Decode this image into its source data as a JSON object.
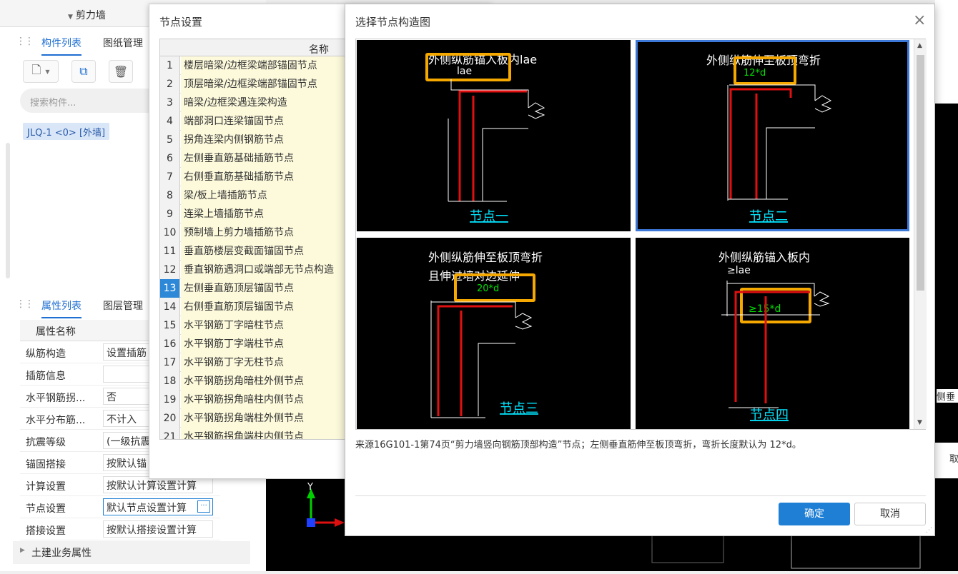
{
  "app": {
    "wall_type": "剪力墙",
    "tabs_top": [
      "构件列表",
      "图纸管理"
    ],
    "search_placeholder": "搜索构件...",
    "component": "JLQ-1 <0> [外墙]",
    "tabs_bottom": [
      "属性列表",
      "图层管理"
    ],
    "prop_header": "属性名称",
    "props": [
      {
        "name": "纵筋构造",
        "value": "设置插筋"
      },
      {
        "name": "插筋信息",
        "value": ""
      },
      {
        "name": "水平钢筋拐...",
        "value": "否"
      },
      {
        "name": "水平分布筋...",
        "value": "不计入"
      },
      {
        "name": "抗震等级",
        "value": "(一级抗震"
      },
      {
        "name": "锚固搭接",
        "value": "按默认锚"
      },
      {
        "name": "计算设置",
        "value": "按默认计算设置计算"
      },
      {
        "name": "节点设置",
        "value": "默认节点设置计算"
      },
      {
        "name": "搭接设置",
        "value": "按默认搭接设置计算"
      }
    ],
    "civil_section": "土建业务属性",
    "right_clipped": "侧垂",
    "right_clipped2": "取"
  },
  "node_dialog": {
    "title": "节点设置",
    "column_header": "名称",
    "rows": [
      {
        "num": "1",
        "name": "楼层暗梁/边框梁端部锚固节点"
      },
      {
        "num": "2",
        "name": "顶层暗梁/边框梁端部锚固节点"
      },
      {
        "num": "3",
        "name": "暗梁/边框梁遇连梁构造"
      },
      {
        "num": "4",
        "name": "端部洞口连梁锚固节点"
      },
      {
        "num": "5",
        "name": "拐角连梁内侧钢筋节点"
      },
      {
        "num": "6",
        "name": "左侧垂直筋基础插筋节点"
      },
      {
        "num": "7",
        "name": "右侧垂直筋基础插筋节点"
      },
      {
        "num": "8",
        "name": "梁/板上墙插筋节点"
      },
      {
        "num": "9",
        "name": "连梁上墙插筋节点"
      },
      {
        "num": "10",
        "name": "预制墙上剪力墙插筋节点"
      },
      {
        "num": "11",
        "name": "垂直筋楼层变截面锚固节点"
      },
      {
        "num": "12",
        "name": "垂直钢筋遇洞口或端部无节点构造"
      },
      {
        "num": "13",
        "name": "左侧垂直筋顶层锚固节点"
      },
      {
        "num": "14",
        "name": "右侧垂直筋顶层锚固节点"
      },
      {
        "num": "15",
        "name": "水平钢筋丁字暗柱节点"
      },
      {
        "num": "16",
        "name": "水平钢筋丁字端柱节点"
      },
      {
        "num": "17",
        "name": "水平钢筋丁字无柱节点"
      },
      {
        "num": "18",
        "name": "水平钢筋拐角暗柱外侧节点"
      },
      {
        "num": "19",
        "name": "水平钢筋拐角暗柱内侧节点"
      },
      {
        "num": "20",
        "name": "水平钢筋拐角端柱外侧节点"
      },
      {
        "num": "21",
        "name": "水平钢筋拐角端柱内侧节点"
      }
    ],
    "selected_row": "13"
  },
  "select_dialog": {
    "title": "选择节点构造图",
    "close": "×",
    "nodes": [
      {
        "heading1": "外侧纵筋锚入板内lae",
        "heading2": "",
        "dim": "lae",
        "dim_green": "",
        "label": "节点一"
      },
      {
        "heading1": "外侧纵筋伸至板顶弯折",
        "heading2": "",
        "dim": "",
        "dim_green": "12*d",
        "label": "节点二"
      },
      {
        "heading1": "外侧纵筋伸至板顶弯折",
        "heading2": "且伸过墙对边延伸",
        "dim": "",
        "dim_green": "20*d",
        "label": "节点三"
      },
      {
        "heading1": "外侧纵筋锚入板内",
        "heading2": "≥lae",
        "dim": "",
        "dim_green": "≥15*d",
        "label": "节点四"
      }
    ],
    "description": "来源16G101-1第74页“剪力墙竖向钢筋顶部构造”节点；左侧垂直筋伸至板顶弯折，弯折长度默认为 12*d。",
    "ok": "确定",
    "cancel": "取消"
  },
  "colors": {
    "accent": "#1f7fd4",
    "highlight_box": "#f5a800",
    "rebar_red": "#e01010",
    "label_cyan": "#00e5ff",
    "dim_green": "#00e000"
  }
}
